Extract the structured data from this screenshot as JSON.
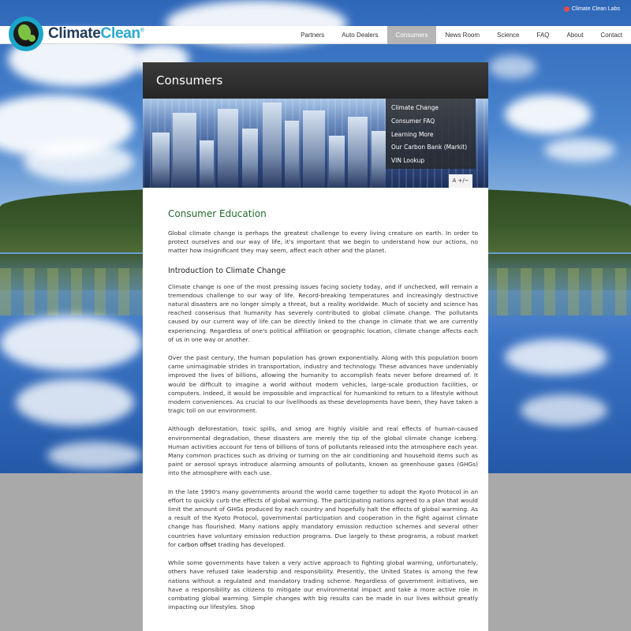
{
  "top_bar": {
    "labs_link": "Climate Clean Labs"
  },
  "logo": {
    "part1": "Climate",
    "part2": "Clean",
    "mark": "®"
  },
  "nav": {
    "items": [
      {
        "label": "Partners"
      },
      {
        "label": "Auto Dealers"
      },
      {
        "label": "Consumers"
      },
      {
        "label": "News Room"
      },
      {
        "label": "Science"
      },
      {
        "label": "FAQ"
      },
      {
        "label": "About"
      },
      {
        "label": "Contact"
      }
    ],
    "active": "Consumers"
  },
  "panel": {
    "title": "Consumers",
    "side_menu": [
      {
        "label": "Climate Change"
      },
      {
        "label": "Consumer FAQ"
      },
      {
        "label": "Learning More"
      },
      {
        "label": "Our Carbon Bank (Markit)"
      },
      {
        "label": "VIN Lookup"
      }
    ],
    "font_tool": "A +/−"
  },
  "article": {
    "heading": "Consumer Education",
    "intro": "Global climate change is perhaps the greatest challenge to every living creature on earth. In order to protect ourselves and our way of life, it's important that we begin to understand how our actions, no matter how insignificant they may seem, affect each other and the planet.",
    "subheading": "Introduction to Climate Change",
    "p1": "Climate change is one of the most pressing issues facing society today, and if unchecked, will remain a tremendous challenge to our way of life. Record-breaking temperatures and increasingly destructive natural disasters are no longer simply a threat, but a reality worldwide. Much of society and science has reached consensus that humanity has severely contributed to global climate change. The pollutants caused by our current way of life can be directly linked to the change in climate that we are currently experiencing. Regardless of one's political affiliation or geographic location, climate change affects each of us in one way or another.",
    "p2": "Over the past century, the human population has grown exponentially. Along with this population boom came unimaginable strides in transportation, industry and technology. These advances have undeniably improved the lives of billions, allowing the humanity to accomplish feats never before dreamed of. It would be difficult to imagine a world without modern vehicles, large-scale production facilities, or computers. Indeed, it would be impossible and impractical for humankind to return to a lifestyle without modern conveniences. As crucial to our livelihoods as these developments have been, they have taken a tragic toll on our environment.",
    "p3": "Although deforestation, toxic spills, and smog are highly visible and real effects of human-caused environmental degradation, these disasters are merely the tip of the global climate change iceberg. Human activities account for tens of billions of tons of pollutants released into the atmosphere each year. Many common practices such as driving or turning on the air conditioning and household items such as paint or aerosol sprays introduce alarming amounts of pollutants, known as greenhouse gases (GHGs) into the atmosphere with each use.",
    "p4_before": "In the late 1990's many governments around the world came together to adopt the Kyoto Protocol in an effort to quickly curb the effects of global warming. The participating nations agreed to a plan that would limit the amount of GHGs produced by each country and hopefully halt the effects of global warming. As a result of the Kyoto Protocol, governmental participation and cooperation in the fight against climate change has flourished. Many nations apply mandatory emission reduction schemes and several other countries have voluntary emission reduction programs. Due largely to these programs, a robust market for ",
    "p4_link": "carbon offset",
    "p4_after": " trading has developed.",
    "p5": "While some governments have taken a very active approach to fighting global warming, unfortunately, others have refused take leadership and responsibility. Presently, the United States is among the few nations without a regulated and mandatory trading scheme. Regardless of government initiatives, we have a responsibility as citizens to mitigate our environmental impact and take a more active role in combating global warming. Simple changes with big results can be made in our lives without greatly impacting our lifestyles. Shop"
  }
}
